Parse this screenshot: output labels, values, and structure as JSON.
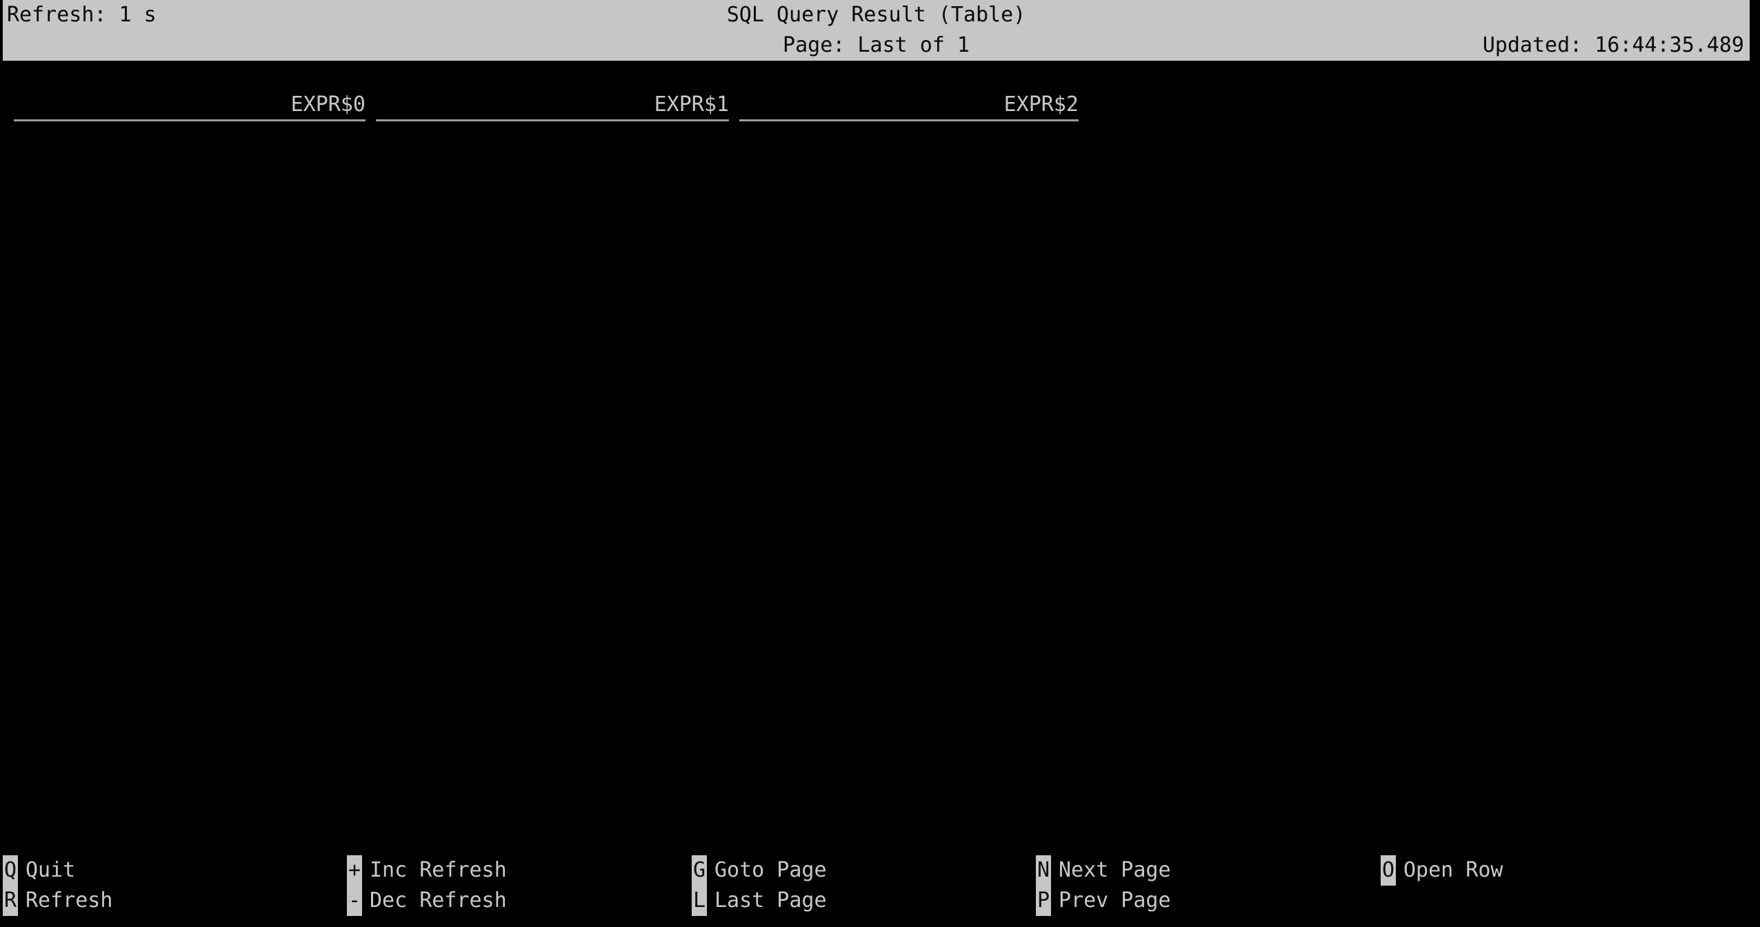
{
  "header": {
    "title": "SQL Query Result (Table)",
    "refresh_label": "Refresh: 1 s",
    "page_label": "Page: Last of 1",
    "updated_label": "Updated: 16:44:35.489",
    "background_color": "#c6c6c6",
    "text_color": "#0a0a0a"
  },
  "table": {
    "columns": [
      {
        "name": "EXPR$0"
      },
      {
        "name": "EXPR$1"
      },
      {
        "name": "EXPR$2"
      }
    ],
    "rows": [],
    "row_count": 0
  },
  "footer": {
    "accent_key_background": "#c6c6c6",
    "accent_key_color": "#101010",
    "groups": [
      {
        "hints": [
          {
            "key": "Q",
            "label": "Quit"
          },
          {
            "key": "R",
            "label": "Refresh"
          }
        ]
      },
      {
        "hints": [
          {
            "key": "+",
            "label": "Inc Refresh"
          },
          {
            "key": "-",
            "label": "Dec Refresh"
          }
        ]
      },
      {
        "hints": [
          {
            "key": "G",
            "label": "Goto Page"
          },
          {
            "key": "L",
            "label": "Last Page"
          }
        ]
      },
      {
        "hints": [
          {
            "key": "N",
            "label": "Next Page"
          },
          {
            "key": "P",
            "label": "Prev Page"
          }
        ]
      },
      {
        "hints": [
          {
            "key": "O",
            "label": "Open Row"
          }
        ]
      }
    ]
  },
  "theme": {
    "background": "#000000",
    "foreground": "#c8c8c8",
    "rule_color": "#9a9a9a"
  }
}
